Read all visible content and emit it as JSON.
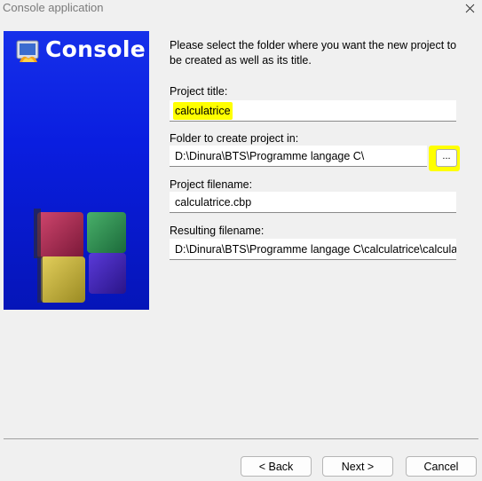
{
  "window": {
    "title": "Console application"
  },
  "banner": {
    "title": "Console"
  },
  "intro_text": "Please select the folder where you want the new project to be created as well as its title.",
  "fields": {
    "project_title": {
      "label": "Project title:",
      "value": "calculatrice"
    },
    "folder": {
      "label": "Folder to create project in:",
      "value": "D:\\Dinura\\BTS\\Programme langage C\\",
      "browse_label": "..."
    },
    "project_filename": {
      "label": "Project filename:",
      "value": "calculatrice.cbp"
    },
    "resulting_filename": {
      "label": "Resulting filename:",
      "value": "D:\\Dinura\\BTS\\Programme langage C\\calculatrice\\calculatrice.cbp"
    }
  },
  "buttons": {
    "back": "< Back",
    "next": "Next >",
    "cancel": "Cancel"
  },
  "colors": {
    "banner_blue": "#0a1ee0",
    "highlight": "#ffff00"
  }
}
